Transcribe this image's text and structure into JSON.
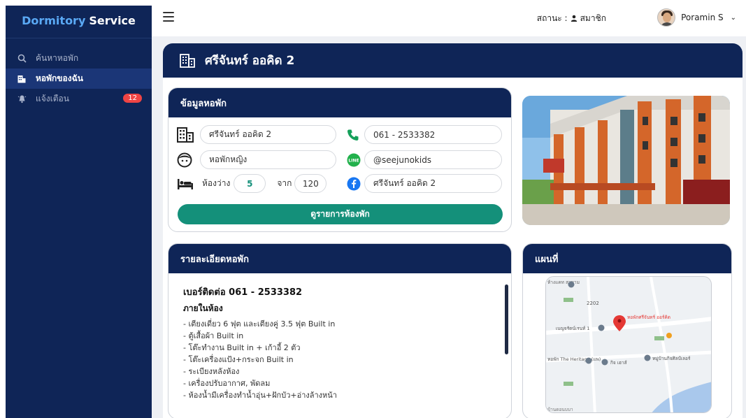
{
  "sidebar": {
    "brand_part1": "Dormitory",
    "brand_part2": "Service",
    "items": [
      {
        "label": "ค้นหาหอพัก",
        "icon": "search-icon"
      },
      {
        "label": "หอพักของฉัน",
        "icon": "building-icon"
      },
      {
        "label": "แจ้งเตือน",
        "icon": "bell-icon",
        "badge": "12"
      }
    ]
  },
  "header": {
    "status_label": "สถานะ :",
    "status_value": "สมาชิก",
    "user_name": "Poramin S"
  },
  "page": {
    "title": "ศรีจันทร์ ออคิด 2"
  },
  "info": {
    "heading": "ข้อมูลหอพัก",
    "name": "ศรีจันทร์ ออคิด 2",
    "phone": "061 - 2533382",
    "type": "หอพักหญิง",
    "line": "@seejunokids",
    "rooms_label": "ห้องว่าง",
    "rooms_available": "5",
    "rooms_of": "จาก",
    "rooms_total": "120",
    "facebook": "ศรีจันทร์ ออคิด 2",
    "button_label": "ดูรายการห้องพัก"
  },
  "detail": {
    "heading": "รายละเอียดหอพัก",
    "phone_line": "เบอร์ติดต่อ 061 - 2533382",
    "section_title": "ภายในห้อง",
    "items": [
      "- เตียงเดี่ยว 6 ฟุต และเตียงคู่ 3.5 ฟุต Built in",
      "- ตู้เสื้อผ้า Built in",
      "- โต๊ะทำงาน Built in + เก้าอี้ 2 ตัว",
      "- โต๊ะเครื่องแป้ง+กระจก Built in",
      "- ระเบียงหลังห้อง",
      "- เครื่องปรับอากาศ, พัดลม",
      "- ห้องน้ำมีเครื่องทำน้ำอุ่น+ฝักบัว+อ่างล้างหน้า"
    ]
  },
  "map": {
    "heading": "แผนที่",
    "labels": {
      "marker": "หอพักศรีจันทร์ ออร์คิด",
      "poi1": "เบญจรัตน์เรนท์ 1",
      "poi2": "หอพัก The Heritage (แพ)",
      "poi3": "กิจ เฮาส์",
      "poi4": "หมู่บ้านกิจศิลป์เลอร์",
      "poi5": "ห้างแคท สาขาม",
      "poi6": "ร้านอาหารบ้านน้อยน้ำ",
      "road": "2202",
      "corner": "บ้านดอนบบา"
    }
  }
}
